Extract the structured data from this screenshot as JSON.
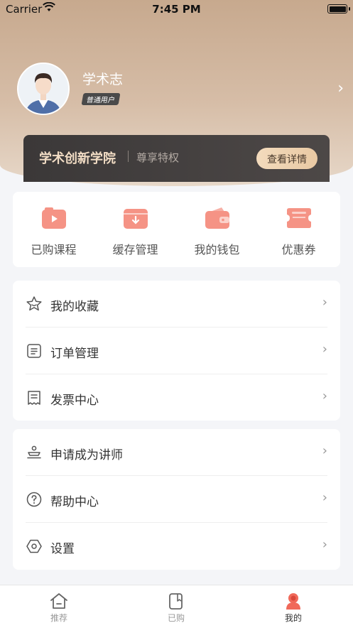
{
  "status_bar": {
    "carrier": "Carrier",
    "time": "7:45 PM"
  },
  "profile": {
    "name": "学术志",
    "badge": "普通用户"
  },
  "vip": {
    "title": "学术创新学院",
    "subtitle": "尊享特权",
    "button": "查看详情"
  },
  "quick_actions": [
    {
      "label": "已购课程",
      "icon": "video-folder-icon"
    },
    {
      "label": "缓存管理",
      "icon": "download-box-icon"
    },
    {
      "label": "我的钱包",
      "icon": "wallet-icon"
    },
    {
      "label": "优惠券",
      "icon": "ticket-icon"
    }
  ],
  "menu_group_1": [
    {
      "label": "我的收藏",
      "icon": "star-icon"
    },
    {
      "label": "订单管理",
      "icon": "order-icon"
    },
    {
      "label": "发票中心",
      "icon": "invoice-icon"
    }
  ],
  "menu_group_2": [
    {
      "label": "申请成为讲师",
      "icon": "lectern-icon"
    },
    {
      "label": "帮助中心",
      "icon": "help-icon"
    },
    {
      "label": "设置",
      "icon": "settings-icon"
    }
  ],
  "tabbar": [
    {
      "label": "推荐",
      "icon": "home-icon",
      "active": false
    },
    {
      "label": "已购",
      "icon": "notebook-icon",
      "active": false
    },
    {
      "label": "我的",
      "icon": "user-icon",
      "active": true
    }
  ],
  "colors": {
    "accent": "#f0695a",
    "icon_pink": "#f7a59a",
    "vip_gold": "#f1dcc4"
  }
}
